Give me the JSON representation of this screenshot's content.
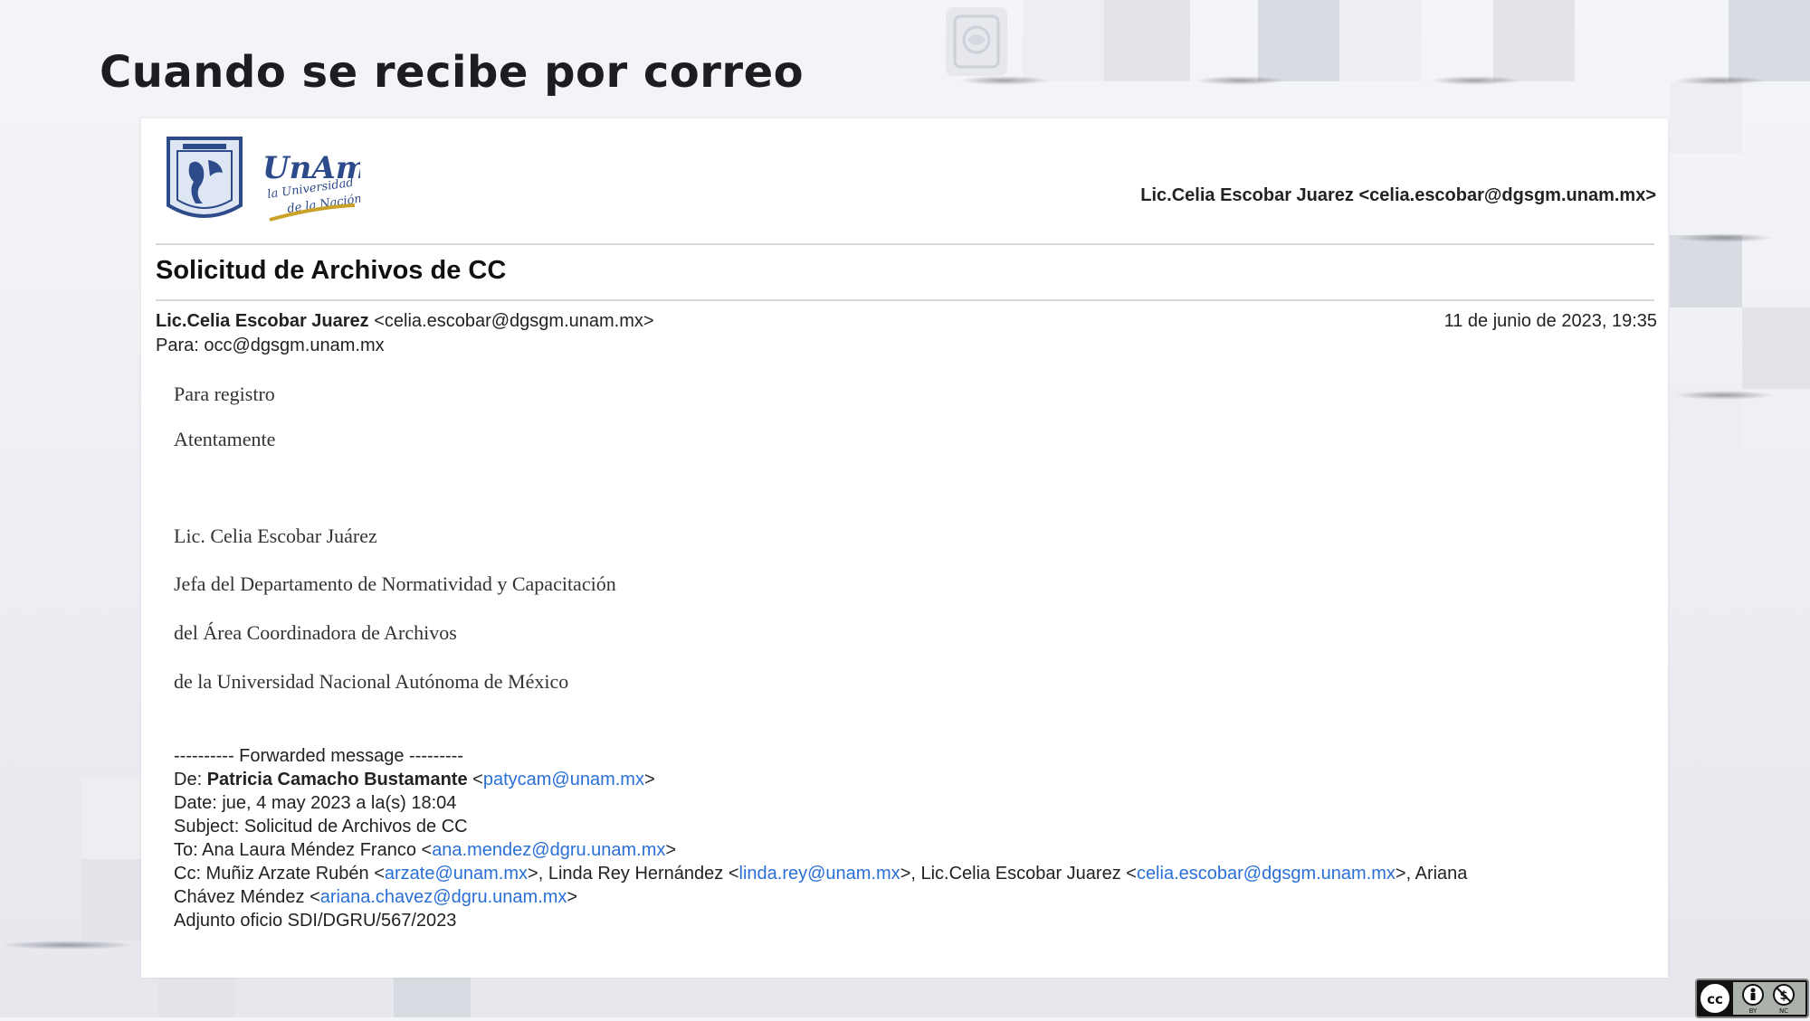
{
  "slide": {
    "title": "Cuando se recibe por correo"
  },
  "email": {
    "header_sender": "Lic.Celia Escobar Juarez <celia.escobar@dgsgm.unam.mx>",
    "subject": "Solicitud de Archivos de CC",
    "from_name": "Lic.Celia Escobar Juarez",
    "from_address": " <celia.escobar@dgsgm.unam.mx>",
    "to_line": "Para: occ@dgsgm.unam.mx",
    "date": "11 de junio de 2023, 19:35",
    "body": {
      "line1": "Para registro",
      "line2": "Atentamente",
      "sig1": "Lic. Celia Escobar Juárez",
      "sig2": "Jefa del Departamento de Normatividad y Capacitación",
      "sig3": "del Área Coordinadora de Archivos",
      "sig4": "de la Universidad Nacional Autónoma de México"
    },
    "forwarded": {
      "separator": "---------- Forwarded message ---------",
      "from_label": "De: ",
      "from_name": "Patricia Camacho Bustamante",
      "from_email": "patycam@unam.mx",
      "date_line": "Date: jue, 4 may 2023 a la(s) 18:04",
      "subject_line": "Subject: Solicitud de Archivos de CC",
      "to_label": "To: Ana Laura Méndez Franco <",
      "to_email": "ana.mendez@dgru.unam.mx",
      "cc_label": "Cc: Muñiz Arzate Rubén <",
      "cc_email1": "arzate@unam.mx",
      "cc_mid1": ">, Linda Rey Hernández <",
      "cc_email2": "linda.rey@unam.mx",
      "cc_mid2": ">, Lic.Celia Escobar Juarez <",
      "cc_email3": "celia.escobar@dgsgm.unam.mx",
      "cc_mid3": ">, Ariana",
      "cc_cont": "Chávez Méndez <",
      "cc_email4": "ariana.chavez@dgru.unam.mx",
      "attachment_line": "Adjunto oficio SDI/DGRU/567/2023"
    }
  },
  "logos": {
    "seal": "unam-seal-icon",
    "unam_text": "UNAM"
  },
  "license": {
    "icons": [
      "cc-icon",
      "by-icon",
      "nc-icon"
    ],
    "by": "BY",
    "nc": "NC"
  },
  "colors": {
    "link": "#2a6fd6",
    "seal_blue": "#2d4a8a",
    "unam_gold": "#c9a227"
  }
}
